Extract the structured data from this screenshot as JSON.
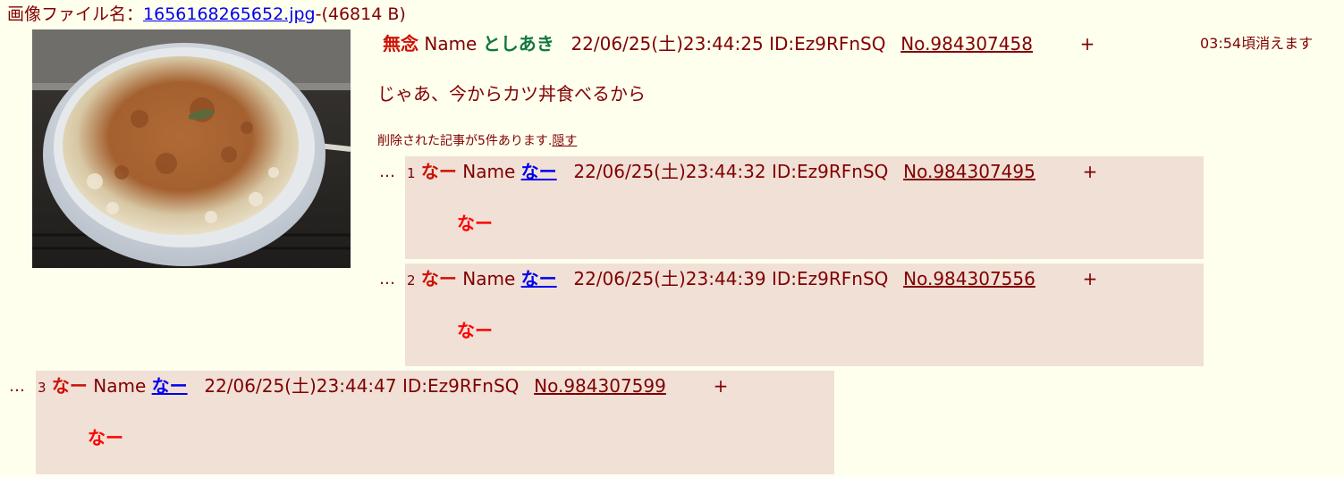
{
  "file": {
    "label": "画像ファイル名：",
    "filename": "1656168265652.jpg",
    "size": "-(46814 B)"
  },
  "op": {
    "subject": "無念",
    "name_label": "Name",
    "name": "としあき",
    "datetime": "22/06/25(土)23:44:25",
    "id": "ID:Ez9RFnSQ",
    "number": "No.984307458",
    "plus": "+",
    "expire": "03:54頃消えます",
    "comment": "じゃあ、今からカツ丼食べるから"
  },
  "deleted_notice": {
    "text": "削除された記事が5件あります.",
    "link": "隠す"
  },
  "replies": [
    {
      "dots": "…",
      "index": "1",
      "subject": "なー",
      "name_label": "Name",
      "name": "なー",
      "datetime": "22/06/25(土)23:44:32",
      "id": "ID:Ez9RFnSQ",
      "number": "No.984307495",
      "plus": "+",
      "comment": "なー"
    },
    {
      "dots": "…",
      "index": "2",
      "subject": "なー",
      "name_label": "Name",
      "name": "なー",
      "datetime": "22/06/25(土)23:44:39",
      "id": "ID:Ez9RFnSQ",
      "number": "No.984307556",
      "plus": "+",
      "comment": "なー"
    },
    {
      "dots": "…",
      "index": "3",
      "subject": "なー",
      "name_label": "Name",
      "name": "なー",
      "datetime": "22/06/25(土)23:44:47",
      "id": "ID:Ez9RFnSQ",
      "number": "No.984307599",
      "plus": "+",
      "comment": "なー"
    }
  ],
  "colors": {
    "background": "#ffffee",
    "reply_background": "#f0e0d6",
    "text": "#800000",
    "subject": "#cc1105",
    "op_name": "#117743",
    "link": "#0000ee",
    "reply_comment": "#ff0000"
  }
}
